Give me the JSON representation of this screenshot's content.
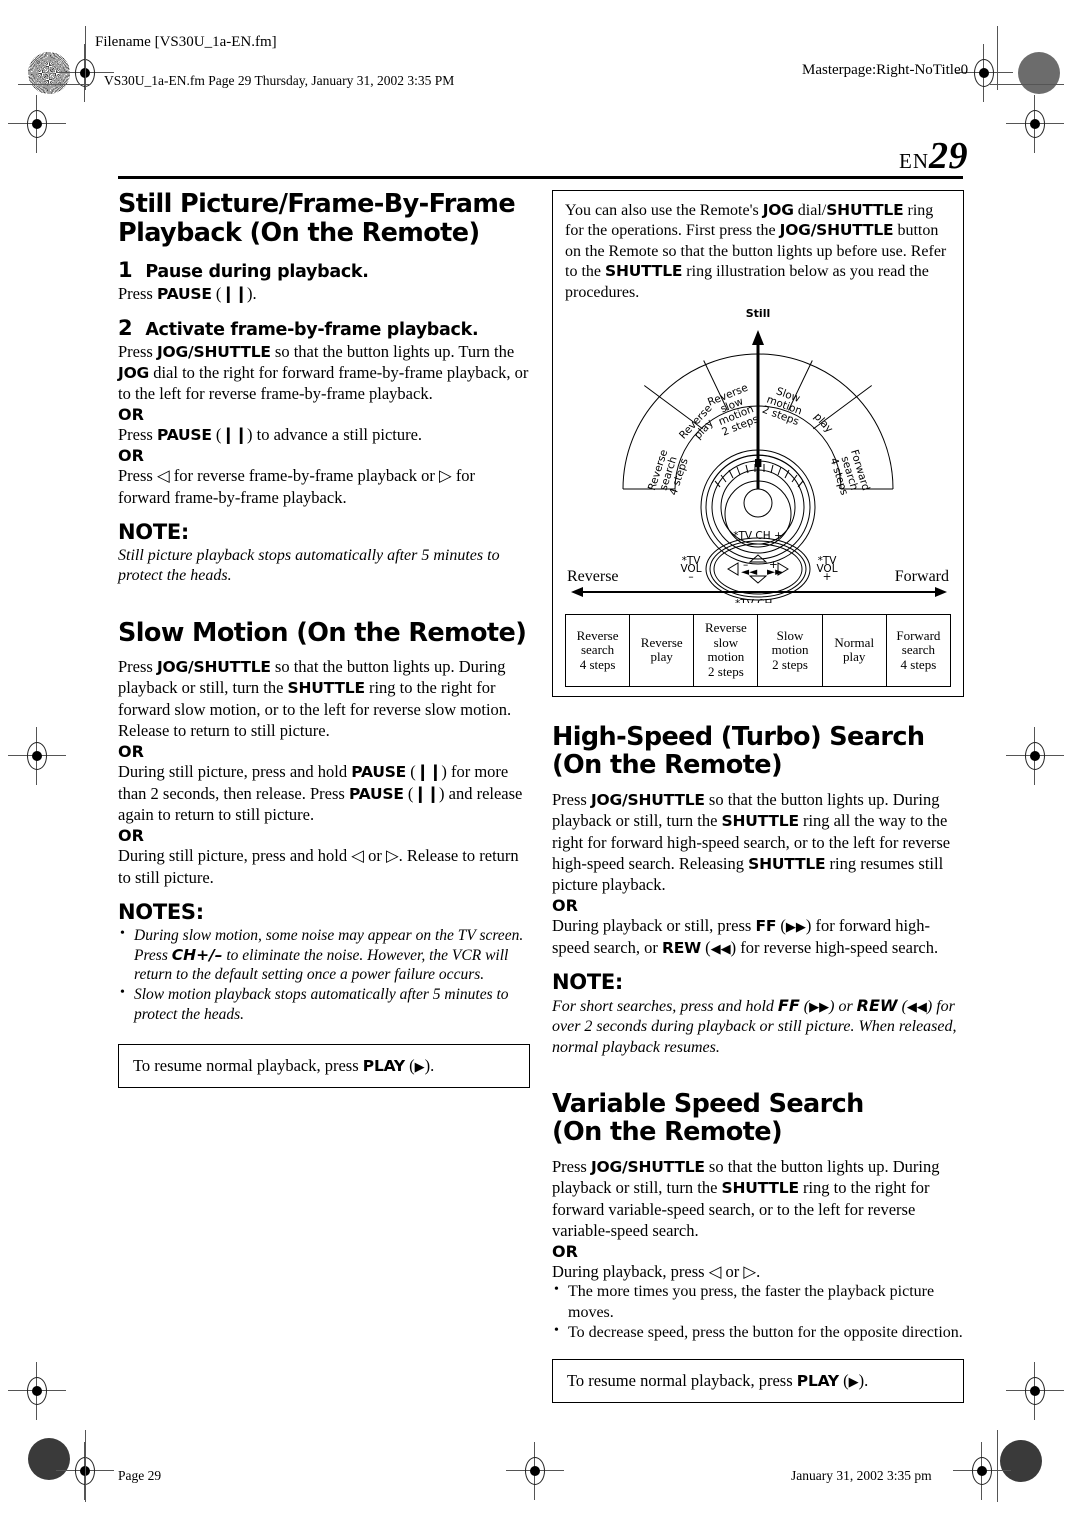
{
  "print_marks": {
    "header_filename_label": "Filename [VS30U_1a-EN.fm]",
    "header_fileinfo": "VS30U_1a-EN.fm  Page 29  Thursday, January 31, 2002  3:35 PM",
    "header_masterpage": "Masterpage:Right-NoTitle0",
    "footer_page": "Page 29",
    "footer_date": "January 31, 2002 3:35 pm"
  },
  "page_number": {
    "prefix": "EN",
    "number": "29"
  },
  "left_column": {
    "section1_title_line1": "Still Picture/Frame-By-Frame",
    "section1_title_line2": "Playback (On the Remote)",
    "steps": [
      {
        "num": "1",
        "heading": "Pause during playback.",
        "body": "Press PAUSE (9).",
        "body_plain": "Press PAUSE (❚❚)."
      },
      {
        "num": "2",
        "heading": "Activate frame-by-frame playback.",
        "body_plain": "Press JOG/SHUTTLE so that the button lights up. Turn the JOG dial to the right for forward frame-by-frame playback, or to the left for reverse frame-by-frame playback."
      }
    ],
    "or_label": "OR",
    "alt1": "Press PAUSE (❚❚) to advance a still picture.",
    "alt2": "Press ◁ for reverse frame-by-frame playback or ▷ for forward frame-by-frame playback.",
    "note_label": "NOTE:",
    "note_text": "Still picture playback stops automatically after 5 minutes to protect the heads.",
    "section2_title": "Slow Motion (On the Remote)",
    "slow_p1": "Press JOG/SHUTTLE so that the button lights up. During playback or still, turn the SHUTTLE ring to the right for forward slow motion, or to the left for reverse slow motion. Release to return to still picture.",
    "slow_p2": "During still picture, press and hold PAUSE (❚❚) for more than 2 seconds, then release. Press PAUSE (❚❚) and release again to return to still picture.",
    "slow_p3": "During still picture, press and hold ◁ or ▷. Release to return to still picture.",
    "notes_label": "NOTES:",
    "notes_items": [
      "During slow motion, some noise may appear on the TV screen. Press CH+/– to eliminate the noise. However, the VCR will return to the default setting once a power failure occurs.",
      "Slow motion playback stops automatically after 5 minutes to protect the heads."
    ],
    "resume_box": "To resume normal playback, press PLAY (▶)."
  },
  "illustration_box": {
    "intro": "You can also use the Remote's JOG dial/SHUTTLE ring for the operations. First press the JOG/SHUTTLE button on the Remote so that the button lights up before use. Refer to the SHUTTLE ring illustration below as you read the procedures.",
    "still_label": "Still",
    "reverse_label": "Reverse",
    "forward_label": "Forward",
    "dial_segments": [
      "Reverse search 4 steps",
      "Reverse play",
      "Reverse slow motion 2 steps",
      "Slow motion 2 steps",
      "play",
      "Forward search 4 steps"
    ],
    "remote_labels": {
      "tv_ch_plus": "*TV CH +",
      "tv_ch_minus": "*TV CH –",
      "tv_vol_minus": "*TV VOL –",
      "tv_vol_plus": "*TV VOL +",
      "rew_sym": "◄◄",
      "ff_sym": "►►",
      "minus": "–",
      "plus": "+"
    },
    "table_cells": [
      [
        "Reverse",
        "search",
        "4 steps"
      ],
      [
        "Reverse",
        "play",
        ""
      ],
      [
        "Reverse",
        "slow",
        "motion",
        "2 steps"
      ],
      [
        "Slow",
        "motion",
        "2 steps"
      ],
      [
        "Normal",
        "play",
        ""
      ],
      [
        "Forward",
        "search",
        "4 steps"
      ]
    ]
  },
  "right_column": {
    "section3_title_line1": "High-Speed (Turbo) Search",
    "section3_title_line2": "(On the Remote)",
    "hs_p1": "Press JOG/SHUTTLE so that the button lights up. During playback or still, turn the SHUTTLE ring all the way to the right for forward high-speed search, or to the left for reverse high-speed search. Releasing SHUTTLE ring resumes still picture playback.",
    "or_label": "OR",
    "hs_p2": "During playback or still, press FF (►►) for forward high-speed search, or REW (◄◄) for reverse high-speed search.",
    "note_label": "NOTE:",
    "note_text": "For short searches, press and hold FF (►►) or REW (◄◄) for over 2 seconds during playback or still picture. When released, normal playback resumes.",
    "section4_title_line1": "Variable Speed Search",
    "section4_title_line2": "(On the Remote)",
    "vs_p1": "Press JOG/SHUTTLE so that the button lights up. During playback or still, turn the SHUTTLE ring to the right for forward variable-speed search, or to the left for reverse variable-speed search.",
    "vs_p2": "During playback, press ◁ or ▷.",
    "vs_bullets": [
      "The more times you press, the faster the playback picture moves.",
      "To decrease speed, press the button for the opposite direction."
    ],
    "resume_box": "To resume normal playback, press PLAY (▶)."
  }
}
